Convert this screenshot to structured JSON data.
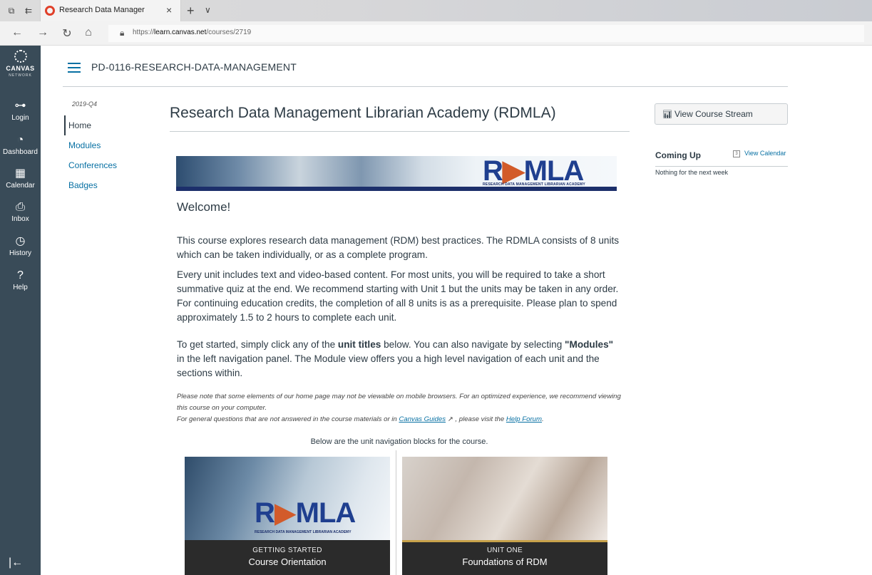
{
  "browser": {
    "tab_title": "Research Data Manager",
    "tab_close": "×",
    "new_tab": "+",
    "tab_dropdown": "∨",
    "url_prefix": "https://",
    "url_host": "learn.canvas.net",
    "url_path": "/courses/2719",
    "icons": [
      "tab-actions-icon",
      "set-aside-tabs-icon",
      "back-icon",
      "forward-icon",
      "refresh-icon",
      "home-icon",
      "lock-icon"
    ]
  },
  "global_nav": {
    "logo_text": "CANVAS",
    "logo_sub": "NETWORK",
    "items": [
      {
        "label": "Login",
        "icon": "⊶"
      },
      {
        "label": "Dashboard",
        "icon": "◔"
      },
      {
        "label": "Calendar",
        "icon": "▦"
      },
      {
        "label": "Inbox",
        "icon": "⎙"
      },
      {
        "label": "History",
        "icon": "◷"
      },
      {
        "label": "Help",
        "icon": "?"
      }
    ],
    "collapse_icon": "|←"
  },
  "course": {
    "breadcrumb": "PD-0116-RESEARCH-DATA-MANAGEMENT",
    "term": "2019-Q4",
    "nav": [
      {
        "label": "Home",
        "active": true
      },
      {
        "label": "Modules"
      },
      {
        "label": "Conferences"
      },
      {
        "label": "Badges"
      }
    ]
  },
  "main": {
    "title": "Research Data Management Librarian Academy (RDMLA)",
    "banner_logo_a": "R",
    "banner_logo_b": "▶",
    "banner_logo_c": "MLA",
    "banner_sub": "RESEARCH DATA MANAGEMENT LIBRARIAN ACADEMY",
    "welcome": "Welcome!",
    "para1": "This course explores research data management (RDM) best practices. The RDMLA consists of 8 units which can be taken individually, or as a complete program.",
    "para2": "Every unit includes text and video-based content. For most units, you will be required to take a short summative quiz at the end. We recommend starting with Unit 1 but the units may be taken in any order.  For continuing education credits, the completion of all 8 units is as a prerequisite. Please plan to spend approximately 1.5 to 2 hours to complete each unit.",
    "para3_a": "To get started, simply click any of the ",
    "para3_b": "unit titles",
    "para3_c": " below. You can also navigate  by selecting ",
    "para3_d": "\"Modules\"",
    "para3_e": " in the left navigation panel. The Module view offers you a high level navigation of each unit and the sections within.",
    "note1": "Please note that some elements of our home page may not be viewable on mobile browsers. For an optimized experience, we recommend viewing this course on your computer.",
    "note2_a": "For general questions that are not answered in the course materials or in ",
    "note2_link1": "Canvas Guides",
    "note2_ext": " ↗",
    "note2_b": " , please visit the ",
    "note2_link2": "Help Forum",
    "note2_c": ".",
    "blocks_intro": "Below are the unit navigation blocks for the course.",
    "blocks": [
      {
        "kicker": "GETTING STARTED",
        "title": "Course Orientation",
        "logo_a": "R",
        "logo_b": "▶",
        "logo_c": "MLA",
        "sub": "RESEARCH DATA MANAGEMENT LIBRARIAN ACADEMY"
      },
      {
        "kicker": "UNIT ONE",
        "title": "Foundations of RDM"
      }
    ]
  },
  "sidebar": {
    "stream_button": "View Course Stream",
    "coming_up": "Coming Up",
    "view_calendar": "View Calendar",
    "cal_day": "3",
    "empty": "Nothing for the next week"
  }
}
